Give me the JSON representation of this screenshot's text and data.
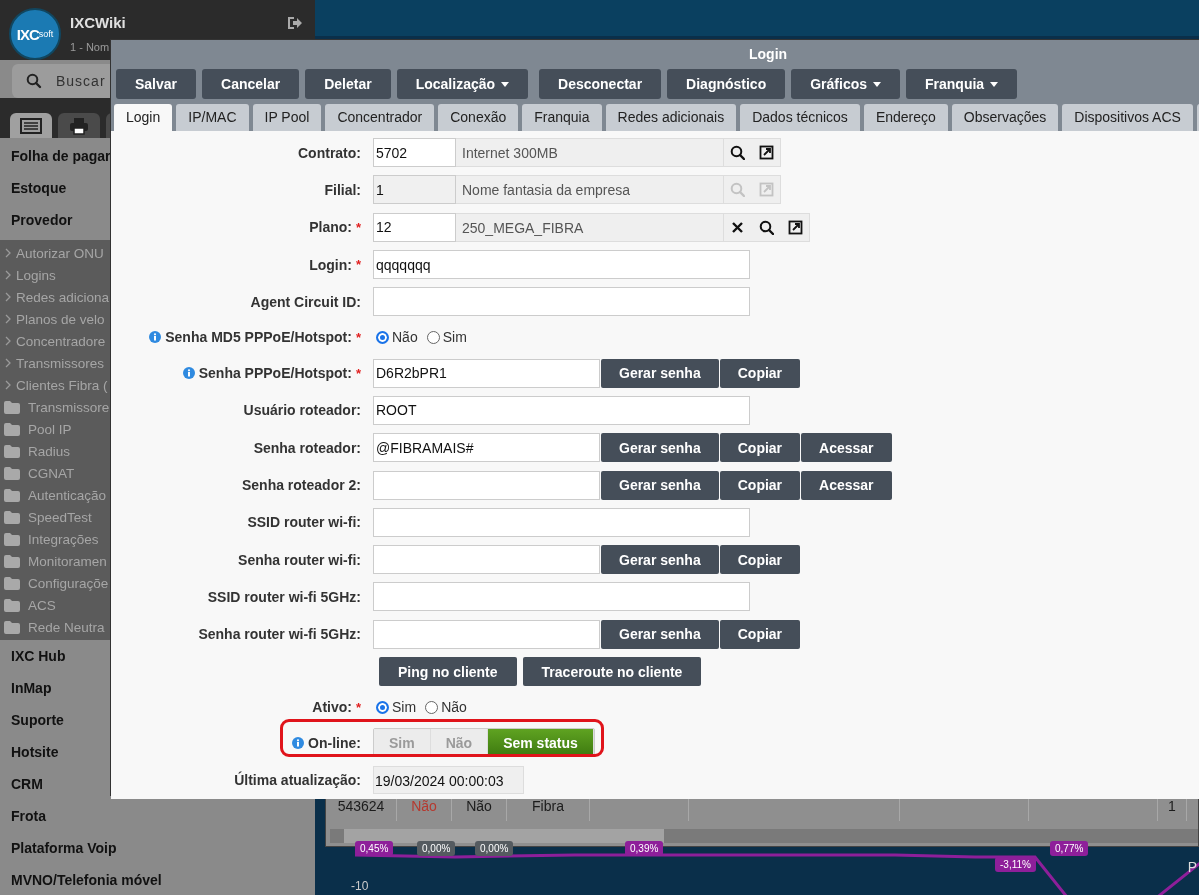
{
  "sidebar": {
    "logo": {
      "main": "IXC",
      "sub": "soft"
    },
    "app_name": "IXCWiki",
    "company": "1 - Nom",
    "search": {
      "placeholder": "Buscar"
    },
    "icon_tabs": [
      {
        "kind": "list",
        "selected": true
      },
      {
        "kind": "print",
        "selected": false
      },
      {
        "kind": "blank",
        "selected": false
      }
    ],
    "top_items": [
      "Folha de pagar",
      "Estoque",
      "Provedor"
    ],
    "sub_items": [
      {
        "kind": "link",
        "label": "Autorizar ONU"
      },
      {
        "kind": "link",
        "label": "Logins"
      },
      {
        "kind": "link",
        "label": "Redes adiciona"
      },
      {
        "kind": "link",
        "label": "Planos de velo"
      },
      {
        "kind": "link",
        "label": "Concentradore"
      },
      {
        "kind": "link",
        "label": "Transmissores"
      },
      {
        "kind": "link",
        "label": "Clientes Fibra ("
      },
      {
        "kind": "folder",
        "label": "Transmissore"
      },
      {
        "kind": "folder",
        "label": "Pool IP"
      },
      {
        "kind": "folder",
        "label": "Radius"
      },
      {
        "kind": "folder",
        "label": "CGNAT"
      },
      {
        "kind": "folder",
        "label": "Autenticação"
      },
      {
        "kind": "folder",
        "label": "SpeedTest"
      },
      {
        "kind": "folder",
        "label": "Integrações"
      },
      {
        "kind": "folder",
        "label": "Monitoramen"
      },
      {
        "kind": "folder",
        "label": "Configuraçõe"
      },
      {
        "kind": "folder",
        "label": "ACS"
      },
      {
        "kind": "folder",
        "label": "Rede Neutra"
      }
    ],
    "bottom_items": [
      "IXC Hub",
      "InMap",
      "Suporte",
      "Hotsite",
      "CRM",
      "Frota",
      "Plataforma Voip",
      "MVNO/Telefonia móvel"
    ]
  },
  "background": {
    "table_row": [
      {
        "text": "543624",
        "negative": false
      },
      {
        "text": "Não",
        "negative": true
      },
      {
        "text": "Não",
        "negative": false
      },
      {
        "text": "Fibra",
        "negative": false
      },
      {
        "text": "1",
        "negative": false
      }
    ],
    "chart_tags": [
      {
        "text": "0,45%",
        "color": "#8e1f9a"
      },
      {
        "text": "0,00%",
        "color": "#555b60"
      },
      {
        "text": "0,00%",
        "color": "#555b60"
      },
      {
        "text": "0,39%",
        "color": "#8e1f9a"
      },
      {
        "text": "-3,11%",
        "color": "#8e1f9a"
      },
      {
        "text": "0,77%",
        "color": "#8e1f9a"
      }
    ],
    "axis_label": "-10",
    "edge_text": "P"
  },
  "modal": {
    "title": "Login",
    "toolbar": [
      {
        "label": "Salvar",
        "dropdown": false
      },
      {
        "label": "Cancelar",
        "dropdown": false
      },
      {
        "label": "Deletar",
        "dropdown": false
      },
      {
        "label": "Localização",
        "dropdown": true
      },
      {
        "label": "Desconectar",
        "dropdown": false
      },
      {
        "label": "Diagnóstico",
        "dropdown": false
      },
      {
        "label": "Gráficos",
        "dropdown": true
      },
      {
        "label": "Franquia",
        "dropdown": true
      }
    ],
    "tabs": [
      {
        "label": "Login",
        "selected": true
      },
      {
        "label": "IP/MAC",
        "selected": false
      },
      {
        "label": "IP Pool",
        "selected": false
      },
      {
        "label": "Concentrador",
        "selected": false
      },
      {
        "label": "Conexão",
        "selected": false
      },
      {
        "label": "Franquia",
        "selected": false
      },
      {
        "label": "Redes adicionais",
        "selected": false
      },
      {
        "label": "Dados técnicos",
        "selected": false
      },
      {
        "label": "Endereço",
        "selected": false
      },
      {
        "label": "Observações",
        "selected": false
      },
      {
        "label": "Dispositivos ACS",
        "selected": false
      },
      {
        "selected": false
      }
    ],
    "fields": [
      {
        "kind": "lookup",
        "label": "Contrato:",
        "info": false,
        "value": "5702",
        "description": "Internet 300MB",
        "disabled": false,
        "clearable": false
      },
      {
        "kind": "lookup",
        "label": "Filial:",
        "info": false,
        "value": "1",
        "description": "Nome fantasia da empresa",
        "disabled": true,
        "clearable": false
      },
      {
        "kind": "lookup",
        "label": "Plano:",
        "required_mark": "*",
        "info": false,
        "value": "12",
        "description": "250_MEGA_FIBRA",
        "disabled": false,
        "clearable": true
      },
      {
        "kind": "text",
        "label": "Login:",
        "required_mark": "*",
        "info": false,
        "value": "qqqqqqq"
      },
      {
        "kind": "text",
        "label": "Agent Circuit ID:",
        "info": false
      },
      {
        "kind": "radio",
        "label": "Senha MD5 PPPoE/Hotspot:",
        "required_mark": "*",
        "info": true,
        "options": [
          {
            "label": "Não",
            "selected": true
          },
          {
            "label": "Sim",
            "selected": false
          }
        ]
      },
      {
        "kind": "text",
        "label": "Senha PPPoE/Hotspot:",
        "required_mark": "*",
        "info": true,
        "value": "D6R2bPR1",
        "buttons": [
          "Gerar senha",
          "Copiar"
        ]
      },
      {
        "kind": "text",
        "label": "Usuário roteador:",
        "info": false,
        "value": "ROOT"
      },
      {
        "kind": "text",
        "label": "Senha roteador:",
        "info": false,
        "value": "@FIBRAMAIS#",
        "buttons": [
          "Gerar senha",
          "Copiar",
          "Acessar"
        ]
      },
      {
        "kind": "text",
        "label": "Senha roteador 2:",
        "info": false,
        "buttons": [
          "Gerar senha",
          "Copiar",
          "Acessar"
        ]
      },
      {
        "kind": "text",
        "label": "SSID router wi-fi:",
        "info": false
      },
      {
        "kind": "text",
        "label": "Senha router wi-fi:",
        "info": false,
        "buttons": [
          "Gerar senha",
          "Copiar"
        ]
      },
      {
        "kind": "text",
        "label": "SSID router wi-fi 5GHz:",
        "info": false
      },
      {
        "kind": "text",
        "label": "Senha router wi-fi 5GHz:",
        "info": false,
        "buttons": [
          "Gerar senha",
          "Copiar"
        ]
      },
      {
        "kind": "actions",
        "buttons": [
          "Ping no cliente",
          "Traceroute no cliente"
        ]
      },
      {
        "kind": "radio",
        "label": "Ativo:",
        "required_mark": "*",
        "info": false,
        "options": [
          {
            "label": "Sim",
            "selected": true
          },
          {
            "label": "Não",
            "selected": false
          }
        ]
      },
      {
        "kind": "toggle",
        "label": "On-line:",
        "info": true,
        "highlighted": true,
        "options": [
          {
            "label": "Sim",
            "selected": false
          },
          {
            "label": "Não",
            "selected": false
          },
          {
            "label": "Sem status",
            "selected": true
          }
        ]
      },
      {
        "kind": "readonly",
        "label": "Última atualização:",
        "info": false,
        "value": "19/03/2024 00:00:03"
      }
    ]
  }
}
